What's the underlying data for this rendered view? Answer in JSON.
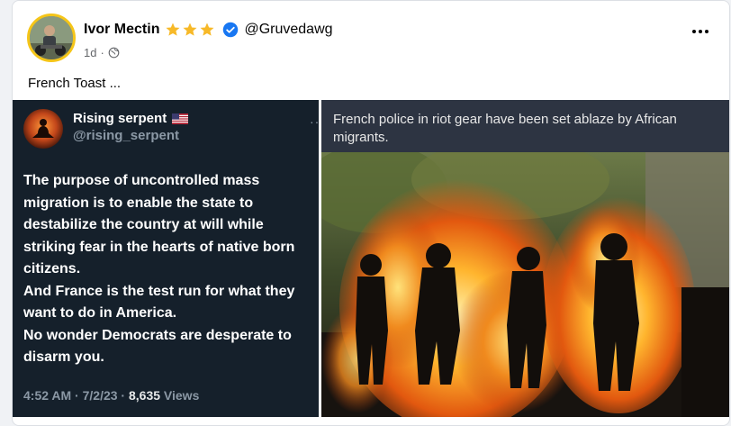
{
  "post": {
    "author_name": "Ivor Mectin",
    "handle": "@Gruvedawg",
    "time": "1d",
    "separator": "·",
    "text": "French Toast ..."
  },
  "tweet": {
    "name": "Rising serpent",
    "handle": "@rising_serpent",
    "more": "···",
    "lines": [
      "The purpose of uncontrolled mass migration is to enable the state to destabilize the country at will while striking fear in the hearts of native born citizens.",
      "And France is the test run for what they want to do in America.",
      "No wonder Democrats are desperate to disarm you."
    ],
    "time": "4:52 AM · 7/2/23 · ",
    "views_count": "8,635",
    "views_label": " Views"
  },
  "photo": {
    "caption": "French police in riot gear have been set ablaze by African migrants."
  },
  "colors": {
    "star": "#f7b928",
    "verified": "#1877f2",
    "tweet_bg": "#15202b",
    "caption_bg": "#2d3442"
  },
  "icons": [
    "star-icon",
    "verified-badge-icon",
    "globe-icon",
    "more-options-icon",
    "us-flag-icon"
  ]
}
